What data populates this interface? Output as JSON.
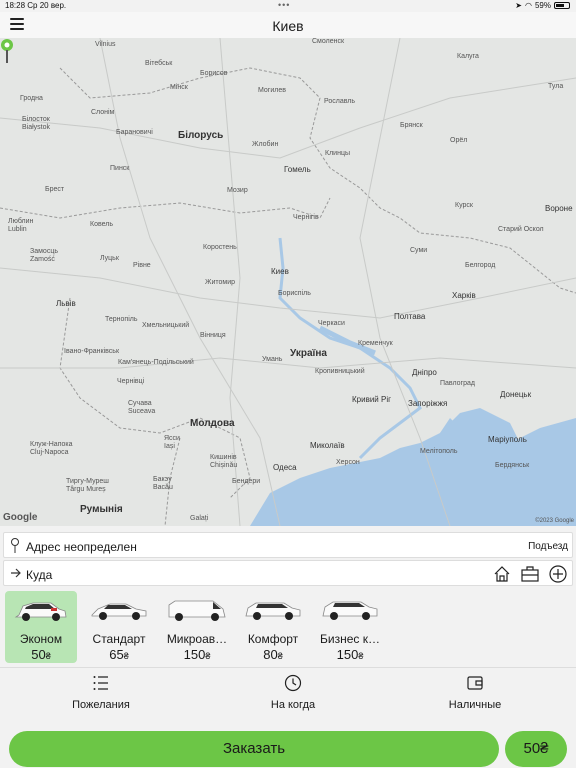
{
  "status": {
    "time": "18:28",
    "date": "Ср 20 вер.",
    "battery": "59%",
    "dots": "•••"
  },
  "header": {
    "title": "Киев"
  },
  "map": {
    "labels": {
      "vilnius": "Vilnius",
      "minsk": "Мінск",
      "smolensk": "Смоленск",
      "kaluga": "Калуга",
      "belarus": "Білорусь",
      "ukraine": "Україна",
      "kiev": "Киев",
      "bryansk": "Брянск",
      "oryol": "Орёл",
      "kursk": "Курск",
      "lublin": "Люблин\nLublin",
      "lviv": "Львів",
      "zhytomyr": "Житомир",
      "kharkiv": "Харків",
      "poltava": "Полтава",
      "dnipro": "Дніпро",
      "zaporizhzhia": "Запоріжжя",
      "kryvyi": "Кривий Ріг",
      "mykolaiv": "Миколаїв",
      "odesa": "Одеса",
      "kherson": "Херсон",
      "moldova": "Молдова",
      "chisinau": "Кишинів\nChișinău",
      "romania": "Румынія",
      "vinnytsia": "Вінниця",
      "chernihiv": "Чернігів",
      "donetsk": "Донецьк",
      "mariupol": "Маріуполь",
      "belgorod": "Белгород",
      "voronezh": "Вороне",
      "tula": "Тула",
      "mogilev": "Могилев",
      "gomel": "Гомель",
      "brest": "Брест",
      "pinsk": "Пинск",
      "rivne": "Рівне",
      "lutsk": "Луцьк",
      "ternopil": "Тернопіль",
      "khmelnytskyi": "Хмельницький",
      "uman": "Умань",
      "cherkasy": "Черкаси",
      "kremenchuk": "Кременчук",
      "kropyvnytskyi": "Кропивницький",
      "sumy": "Суми",
      "iasi": "Ясси\nIași",
      "bialystok": "Білосток\nBiałystok",
      "chernivtsi": "Чернівці",
      "ivano": "Івано-Франківськ",
      "suceava": "Сучава\nSuceava",
      "kluj": "Клуж-Напока\nCluj-Napoca",
      "boryspil": "Бориспіль",
      "pavlograd": "Павлоград",
      "melitopol": "Мелітополь",
      "berdiansk": "Бердянськ",
      "mozyr": "Мозир",
      "zhlobin": "Жлобин",
      "baranovichi": "Барановичі",
      "slonim": "Слонім",
      "grodno": "Гродна",
      "borisov": "Борисов",
      "vitebsk": "Вітебськ",
      "klintsy": "Клинцы",
      "roslavl": "Рославль",
      "starobelsk": "Старий Оскол",
      "korosten": "Коростень",
      "kamianets": "Кам'янець-Подільський",
      "galati": "Galați",
      "tighina": "Бендери",
      "bakau": "Бакэу\nBacău",
      "targu": "Тиргу-Муреш\nTârgu Mureș",
      "kovel": "Ковель",
      "zamosc": "Замосць\nZamość"
    },
    "google": "Google",
    "copyright": "©2023 Google"
  },
  "from": {
    "label": "Адрес неопределен",
    "entrance": "Подъезд"
  },
  "to": {
    "label": "Куда"
  },
  "tariffs": [
    {
      "name": "Эконом",
      "price": "50",
      "currency": "₴",
      "selected": true,
      "car_color": "#ffffff"
    },
    {
      "name": "Стандарт",
      "price": "65",
      "currency": "₴",
      "selected": false,
      "car_color": "#ffffff"
    },
    {
      "name": "Микроав…",
      "price": "150",
      "currency": "₴",
      "selected": false,
      "car_color": "#ffffff"
    },
    {
      "name": "Комфорт",
      "price": "80",
      "currency": "₴",
      "selected": false,
      "car_color": "#ffffff"
    },
    {
      "name": "Бизнес к…",
      "price": "150",
      "currency": "₴",
      "selected": false,
      "car_color": "#ffffff"
    }
  ],
  "options": {
    "wishes": "Пожелания",
    "when": "На когда",
    "payment": "Наличные"
  },
  "order": {
    "label": "Заказать",
    "price": "50₴"
  },
  "colors": {
    "accent": "#6cc646",
    "selected": "#b8e5b4",
    "pin": "#6cc646",
    "water": "#a8c8e6"
  }
}
